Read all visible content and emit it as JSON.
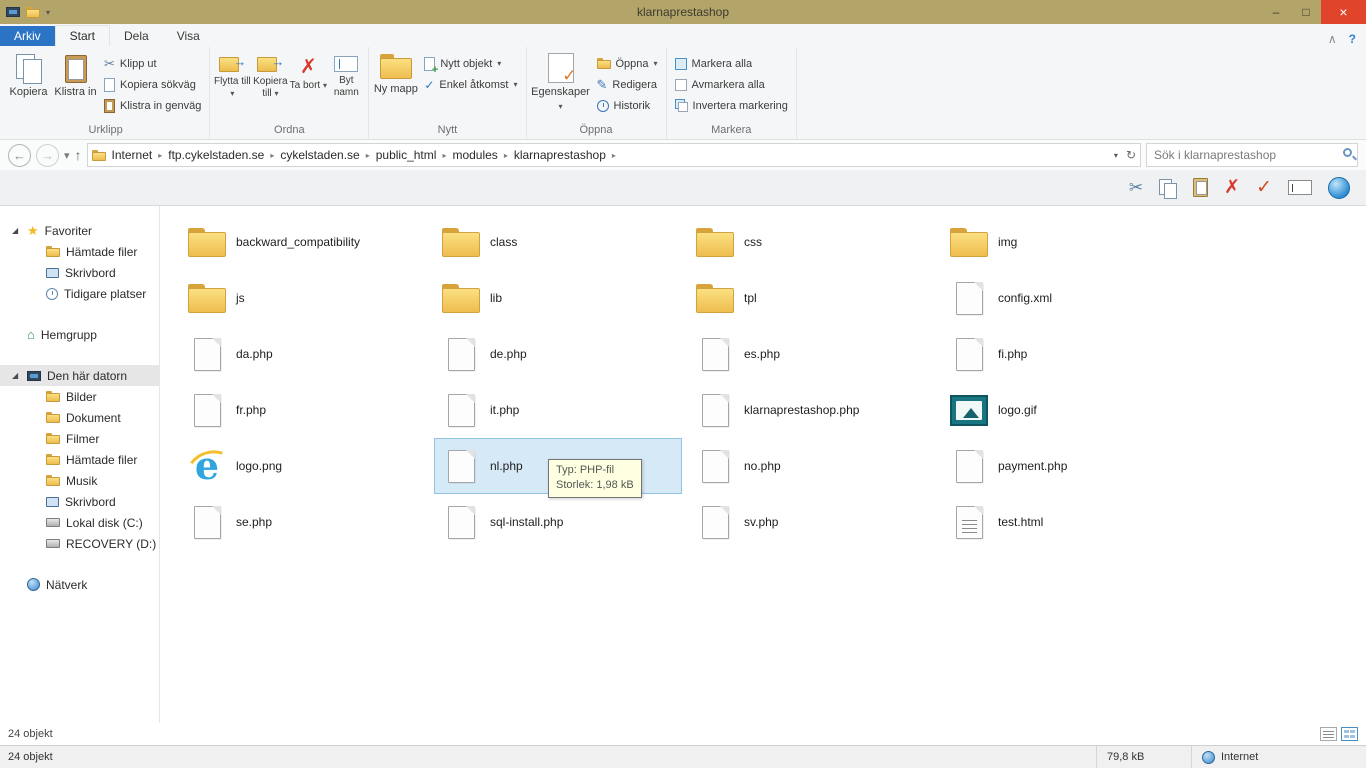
{
  "window": {
    "title": "klarnaprestashop"
  },
  "icons": {
    "minimize": "–",
    "maximize": "□",
    "close": "×",
    "chevron_up": "∧",
    "help": "?",
    "dropdown": "▾",
    "back": "←",
    "forward": "→",
    "up": "↑",
    "refresh": "↻",
    "crumb_sep": "▸",
    "expanded": "◢",
    "cut": "✂",
    "delete_x": "✗",
    "check": "✓",
    "pencil": "✎",
    "star": "★",
    "house": "⌂",
    "ie_e": "e"
  },
  "ribbon": {
    "tabs": [
      {
        "label": "Arkiv"
      },
      {
        "label": "Start"
      },
      {
        "label": "Dela"
      },
      {
        "label": "Visa"
      }
    ],
    "urklipp": {
      "name": "Urklipp",
      "kopiera": "Kopiera",
      "klistra_in": "Klistra in",
      "klipp_ut": "Klipp ut",
      "kopiera_sokvag": "Kopiera sökväg",
      "klistra_in_genvag": "Klistra in genväg"
    },
    "ordna": {
      "name": "Ordna",
      "flytta_till": "Flytta till",
      "kopiera_till": "Kopiera till",
      "ta_bort": "Ta bort",
      "byt_namn": "Byt namn"
    },
    "nytt": {
      "name": "Nytt",
      "ny_mapp": "Ny mapp",
      "nytt_objekt": "Nytt objekt",
      "enkel_atkomst": "Enkel åtkomst"
    },
    "oppna": {
      "name": "Öppna",
      "egenskaper": "Egenskaper",
      "oppna": "Öppna",
      "redigera": "Redigera",
      "historik": "Historik"
    },
    "markera": {
      "name": "Markera",
      "markera_alla": "Markera alla",
      "avmarkera_alla": "Avmarkera alla",
      "invertera": "Invertera markering"
    }
  },
  "addressbar": {
    "breadcrumbs": [
      "Internet",
      "ftp.cykelstaden.se",
      "cykelstaden.se",
      "public_html",
      "modules",
      "klarnaprestashop"
    ],
    "search_placeholder": "Sök i klarnaprestashop"
  },
  "sidebar": {
    "favoriter": {
      "label": "Favoriter",
      "items": [
        "Hämtade filer",
        "Skrivbord",
        "Tidigare platser"
      ]
    },
    "hemgrupp": {
      "label": "Hemgrupp"
    },
    "den_har_datorn": {
      "label": "Den här datorn",
      "items": [
        "Bilder",
        "Dokument",
        "Filmer",
        "Hämtade filer",
        "Musik",
        "Skrivbord",
        "Lokal disk (C:)",
        "RECOVERY (D:)"
      ]
    },
    "natverk": {
      "label": "Nätverk"
    }
  },
  "files": [
    {
      "name": "backward_compatibility",
      "type": "folder"
    },
    {
      "name": "class",
      "type": "folder"
    },
    {
      "name": "css",
      "type": "folder"
    },
    {
      "name": "img",
      "type": "folder"
    },
    {
      "name": "js",
      "type": "folder"
    },
    {
      "name": "lib",
      "type": "folder"
    },
    {
      "name": "tpl",
      "type": "folder"
    },
    {
      "name": "config.xml",
      "type": "file"
    },
    {
      "name": "da.php",
      "type": "file"
    },
    {
      "name": "de.php",
      "type": "file"
    },
    {
      "name": "es.php",
      "type": "file"
    },
    {
      "name": "fi.php",
      "type": "file"
    },
    {
      "name": "fr.php",
      "type": "file"
    },
    {
      "name": "it.php",
      "type": "file"
    },
    {
      "name": "klarnaprestashop.php",
      "type": "file"
    },
    {
      "name": "logo.gif",
      "type": "image"
    },
    {
      "name": "logo.png",
      "type": "ie"
    },
    {
      "name": "nl.php",
      "type": "file",
      "selected": true
    },
    {
      "name": "no.php",
      "type": "file"
    },
    {
      "name": "payment.php",
      "type": "file"
    },
    {
      "name": "se.php",
      "type": "file"
    },
    {
      "name": "sql-install.php",
      "type": "file"
    },
    {
      "name": "sv.php",
      "type": "file"
    },
    {
      "name": "test.html",
      "type": "text"
    }
  ],
  "tooltip": {
    "type_line": "Typ: PHP-fil",
    "size_line": "Storlek: 1,98 kB"
  },
  "statusbar": {
    "items_text": "24 objekt",
    "size": "79,8 kB",
    "zone": "Internet"
  }
}
